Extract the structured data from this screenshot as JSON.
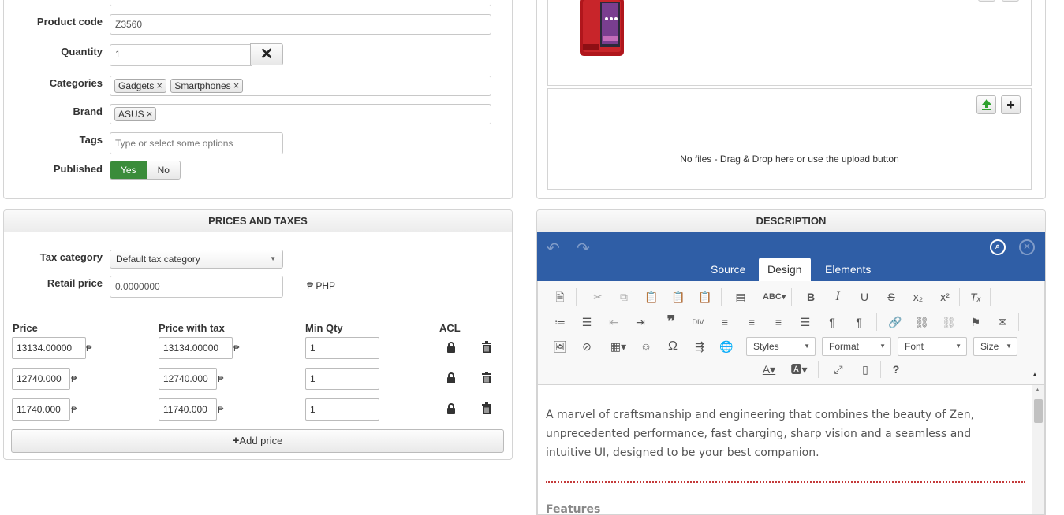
{
  "product": {
    "code_label": "Product code",
    "code_value": "Z3560",
    "quantity_label": "Quantity",
    "quantity_value": "1",
    "categories_label": "Categories",
    "categories": [
      "Gadgets",
      "Smartphones"
    ],
    "brand_label": "Brand",
    "brands": [
      "ASUS"
    ],
    "tags_label": "Tags",
    "tags_placeholder": "Type or select some options",
    "published_label": "Published",
    "published_yes": "Yes",
    "published_no": "No",
    "published_selected": "Yes"
  },
  "media": {
    "empty_message": "No files - Drag & Drop here or use the upload button"
  },
  "prices": {
    "title": "PRICES AND TAXES",
    "tax_category_label": "Tax category",
    "tax_category_value": "Default tax category",
    "retail_price_label": "Retail price",
    "retail_price_value": "0.0000000",
    "currency": "₱ PHP",
    "currency_symbol": "₱",
    "headers": {
      "price": "Price",
      "price_with_tax": "Price with tax",
      "min_qty": "Min Qty",
      "acl": "ACL"
    },
    "rows": [
      {
        "price": "13134.00000",
        "price_with_tax": "13134.00000",
        "min_qty": "1"
      },
      {
        "price": "12740.000",
        "price_with_tax": "12740.000",
        "min_qty": "1"
      },
      {
        "price": "11740.000",
        "price_with_tax": "11740.000",
        "min_qty": "1"
      }
    ],
    "add_price_label": "Add price"
  },
  "description": {
    "title": "DESCRIPTION",
    "tabs": [
      "Source",
      "Design",
      "Elements"
    ],
    "active_tab": "Design",
    "combos": {
      "styles": "Styles",
      "format": "Format",
      "font": "Font",
      "size": "Size"
    },
    "paragraph": "A marvel of craftsmanship and engineering that combines the beauty of Zen, unprecedented performance, fast charging, sharp vision and a seamless and intuitive UI, designed to be your best companion.",
    "subheading": "Features"
  },
  "colors": {
    "editor_bar": "#2f5ea6",
    "published_on": "#3a8c3a",
    "divider": "#c43a3a"
  }
}
